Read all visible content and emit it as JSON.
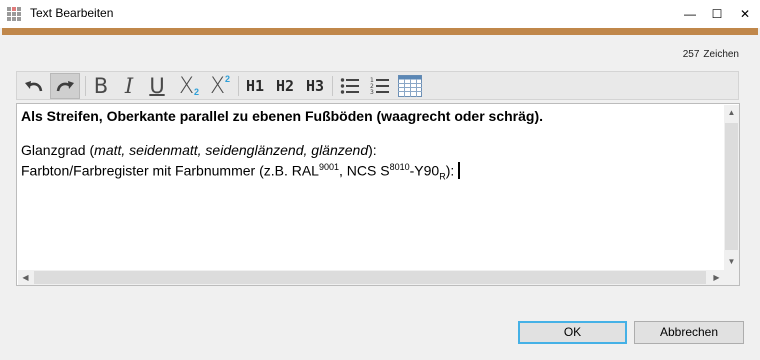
{
  "window": {
    "title": "Text Bearbeiten",
    "minimize_glyph": "—",
    "maximize_glyph": "☐",
    "close_glyph": "✕"
  },
  "counter": {
    "count": "257",
    "label": "Zeichen"
  },
  "toolbar": {
    "icons": [
      "undo-icon",
      "redo-icon",
      "bold-icon",
      "italic-icon",
      "underline-icon",
      "subscript-icon",
      "superscript-icon",
      "heading1-icon",
      "heading2-icon",
      "heading3-icon",
      "bullet-list-icon",
      "numbered-list-icon",
      "table-icon"
    ],
    "bold_glyph": "B",
    "italic_glyph": "I",
    "underline_glyph": "U",
    "sub_glyph": "X",
    "sub_num": "2",
    "sup_glyph": "X",
    "sup_num": "2",
    "h1": "H1",
    "h2": "H2",
    "h3": "H3"
  },
  "editor": {
    "line1": "Als Streifen, Oberkante parallel zu ebenen Fußböden (waagrecht oder schräg).",
    "line3_a": "Glanzgrad (",
    "line3_b": "matt, seidenmatt, seidenglänzend, glänzend",
    "line3_c": "):",
    "line4_a": "Farbton/Farbregister mit Farbnummer (z.B. RAL",
    "line4_sup1": "9001",
    "line4_b": ", NCS S",
    "line4_sup2": "8010",
    "line4_c": "-Y90",
    "line4_sub": "R",
    "line4_d": "):"
  },
  "buttons": {
    "ok": "OK",
    "cancel": "Abbrechen"
  },
  "colors": {
    "accent_bar": "#c0874a",
    "ok_border": "#45b1e6"
  }
}
